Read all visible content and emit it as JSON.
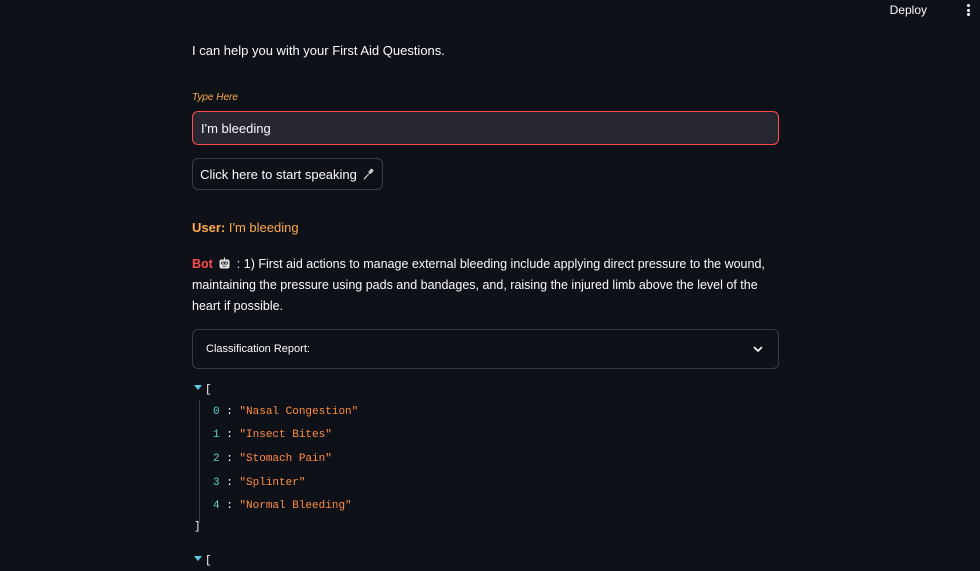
{
  "header": {
    "deploy_label": "Deploy",
    "menu_icon": "kebab-menu-icon"
  },
  "intro": "I can help you with your First Aid Questions.",
  "input": {
    "label": "Type Here",
    "value": "I'm bleeding"
  },
  "speak_button": {
    "label": "Click here to start speaking",
    "icon": "microphone-icon"
  },
  "chat": {
    "user_label": "User:",
    "user_text": "I'm bleeding",
    "bot_label": "Bot",
    "bot_icon": "robot-icon",
    "bot_text": ": 1) First aid actions to manage external bleeding include applying direct pressure to the wound, maintaining the pressure using pads and bandages, and, raising the injured limb above the level of the heart if possible."
  },
  "expander": {
    "label": "Classification Report:",
    "icon": "chevron-down-icon"
  },
  "json_list": {
    "open": "[",
    "close": "]",
    "items": [
      {
        "index": "0",
        "value": "\"Nasal Congestion\""
      },
      {
        "index": "1",
        "value": "\"Insect Bites\""
      },
      {
        "index": "2",
        "value": "\"Stomach Pain\""
      },
      {
        "index": "3",
        "value": "\"Splinter\""
      },
      {
        "index": "4",
        "value": "\"Normal Bleeding\""
      }
    ],
    "second_open": "["
  },
  "colors": {
    "background": "#0e1117",
    "accent_red": "#ff4b4b",
    "accent_orange": "#ffa94d",
    "json_index": "#5cd6c4",
    "json_string": "#ff8c42"
  }
}
